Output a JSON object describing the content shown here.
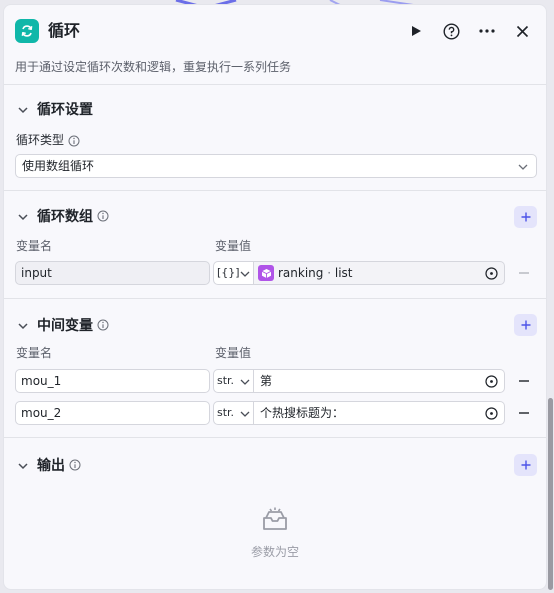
{
  "header": {
    "title": "循环",
    "icon": "loop-icon",
    "actions": [
      "run-icon",
      "help-icon",
      "more-icon",
      "close-icon"
    ]
  },
  "description": "用于通过设定循环次数和逻辑，重复执行一系列任务",
  "loop_settings": {
    "title": "循环设置",
    "type_label": "循环类型",
    "type_value": "使用数组循环"
  },
  "loop_array": {
    "title": "循环数组",
    "col_name": "变量名",
    "col_value": "变量值",
    "rows": [
      {
        "name": "input",
        "type": "[{}]",
        "ref_node": "ranking",
        "ref_sep": "·",
        "ref_field": "list"
      }
    ]
  },
  "intermediate": {
    "title": "中间变量",
    "col_name": "变量名",
    "col_value": "变量值",
    "rows": [
      {
        "name": "mou_1",
        "type": "str.",
        "value": "第"
      },
      {
        "name": "mou_2",
        "type": "str.",
        "value": "个热搜标题为："
      }
    ]
  },
  "output": {
    "title": "输出",
    "empty_text": "参数为空"
  },
  "colors": {
    "accent": "#10b7a9",
    "add_button_bg": "#e4e4fb",
    "add_button_fg": "#4d53e8",
    "ref_chip": "#b054e8"
  }
}
